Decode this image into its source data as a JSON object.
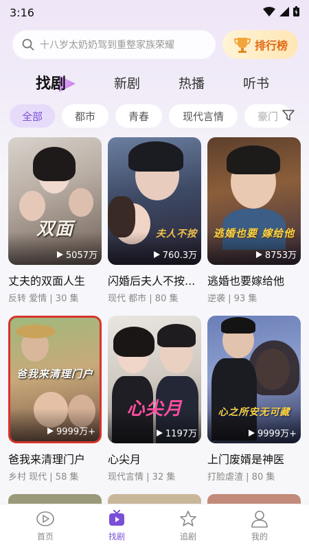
{
  "status": {
    "time": "3:16"
  },
  "search": {
    "placeholder": "十八岁太奶奶驾到重整家族荣耀"
  },
  "ranking": {
    "label": "排行榜"
  },
  "tabs": [
    {
      "label": "找剧",
      "active": true
    },
    {
      "label": "新剧"
    },
    {
      "label": "热播"
    },
    {
      "label": "听书"
    }
  ],
  "chips": [
    {
      "label": "全部",
      "active": true
    },
    {
      "label": "都市"
    },
    {
      "label": "青春"
    },
    {
      "label": "现代言情"
    },
    {
      "label": "豪门"
    }
  ],
  "dramas": [
    {
      "title": "丈夫的双面人生",
      "tags": "反转 爱情",
      "episodes": "30 集",
      "views": "5057万",
      "overlay": "双面"
    },
    {
      "title": "闪婚后夫人不按...",
      "tags": "现代 都市",
      "episodes": "80 集",
      "views": "760.3万",
      "overlay": "夫人不按"
    },
    {
      "title": "逃婚也要嫁给他",
      "tags": "逆袭",
      "episodes": "93 集",
      "views": "8753万",
      "overlay": "逃婚也要 嫁给他"
    },
    {
      "title": "爸我来清理门户",
      "tags": "乡村 现代",
      "episodes": "58 集",
      "views": "9999万+",
      "overlay": "爸我来清理门户"
    },
    {
      "title": "心尖月",
      "tags": "现代言情",
      "episodes": "32 集",
      "views": "1197万",
      "overlay": "心尖月"
    },
    {
      "title": "上门废婿是神医",
      "tags": "打脸虐渣",
      "episodes": "80 集",
      "views": "9999万+",
      "overlay": "心之所安无可藏"
    }
  ],
  "nav": [
    {
      "label": "首页"
    },
    {
      "label": "找剧",
      "active": true
    },
    {
      "label": "追剧"
    },
    {
      "label": "我的"
    }
  ],
  "colors": {
    "accent": "#7a4fd6",
    "rank": "#e06a13"
  }
}
